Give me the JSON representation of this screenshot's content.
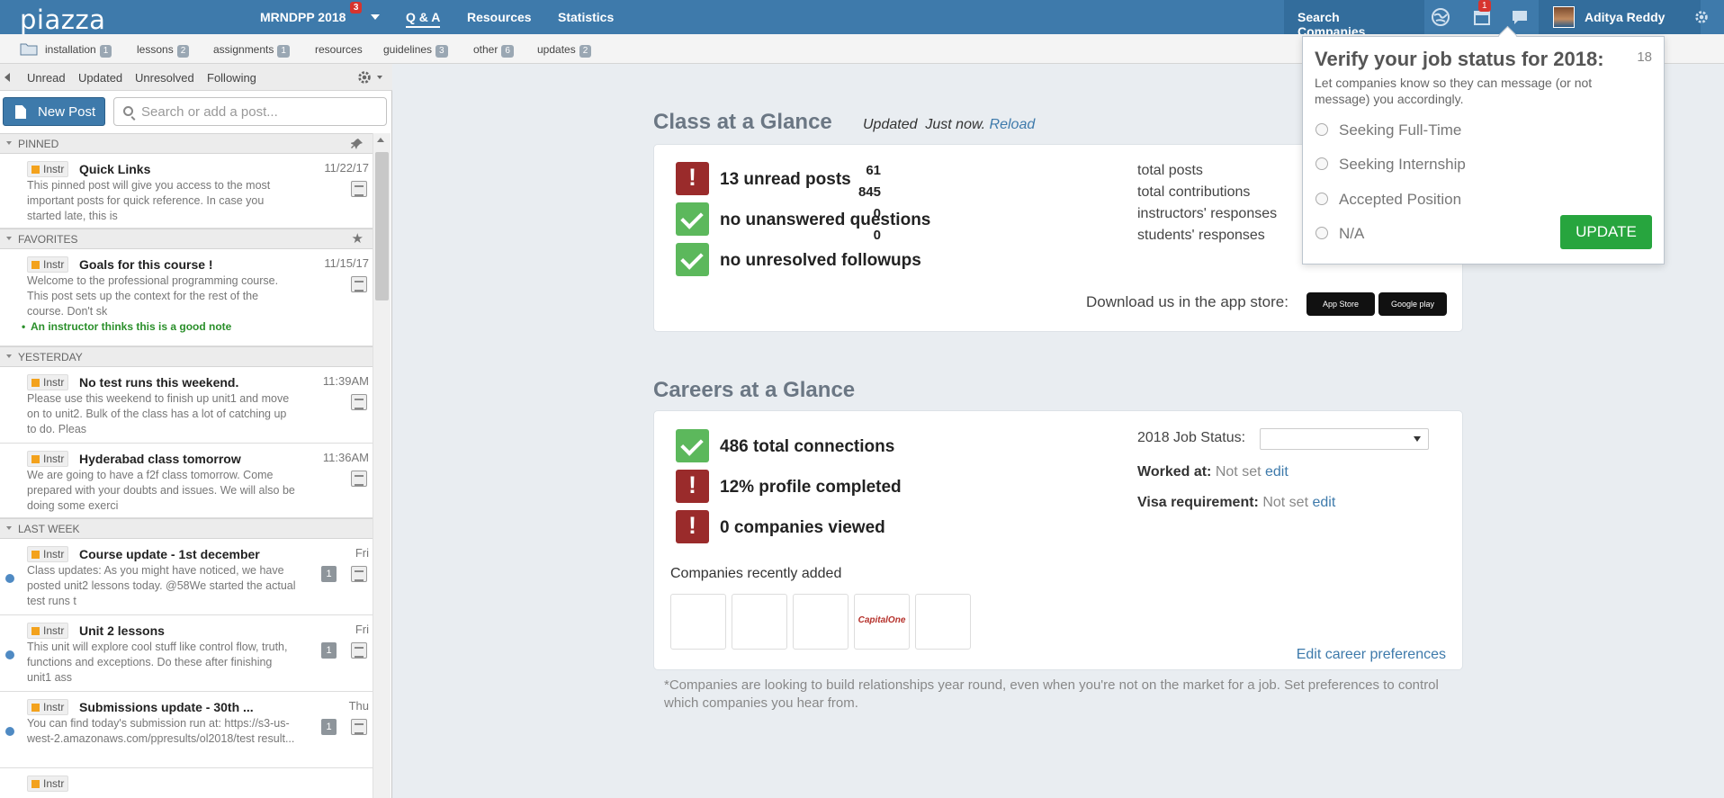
{
  "app": {
    "logo": "piazza"
  },
  "topbar": {
    "course": "MRNDPP 2018",
    "course_badge": "3",
    "nav": [
      "Q & A",
      "Resources",
      "Statistics"
    ],
    "search_companies": "Search Companies",
    "calendar_badge": "1",
    "user_name": "Aditya Reddy"
  },
  "folders": [
    {
      "label": "installation",
      "count": "1"
    },
    {
      "label": "lessons",
      "count": "2"
    },
    {
      "label": "assignments",
      "count": "1"
    },
    {
      "label": "resources",
      "count": ""
    },
    {
      "label": "guidelines",
      "count": "3"
    },
    {
      "label": "other",
      "count": "6"
    },
    {
      "label": "updates",
      "count": "2"
    }
  ],
  "filters": [
    "Unread",
    "Updated",
    "Unresolved",
    "Following"
  ],
  "sidebar": {
    "new_post": "New Post",
    "search_placeholder": "Search or add a post...",
    "sections": {
      "pinned": "PINNED",
      "favorites": "FAVORITES",
      "yesterday": "YESTERDAY",
      "last_week": "LAST WEEK"
    },
    "posts": [
      {
        "tag": "Instr",
        "title": "Quick Links",
        "date": "11/22/17",
        "body": "This pinned post will give you access to the most important posts for quick reference. In case you started late, this is"
      },
      {
        "tag": "Instr",
        "title": "Goals for this course !",
        "date": "11/15/17",
        "body": "Welcome to the professional programming course.  This post sets up the context for the rest of the course.  Don't sk",
        "note": "An instructor thinks this is a good note"
      },
      {
        "tag": "Instr",
        "title": "No test runs this weekend.",
        "date": "11:39AM",
        "body": "Please use this weekend to finish up unit1 and move on to unit2. Bulk of the class has a lot of catching up to do. Pleas"
      },
      {
        "tag": "Instr",
        "title": "Hyderabad class tomorrow",
        "date": "11:36AM",
        "body": "We are going to have a f2f class tomorrow. Come prepared with your doubts and issues. We will also be doing some exerci"
      },
      {
        "tag": "Instr",
        "title": "Course update - 1st december",
        "date": "Fri",
        "count": "1",
        "body": "Class updates:   As you might have noticed, we have posted unit2 lessons today. @58We started the actual test runs t"
      },
      {
        "tag": "Instr",
        "title": "Unit 2 lessons",
        "date": "Fri",
        "count": "1",
        "body": "This unit will explore cool stuff like control flow, truth, functions and exceptions. Do these after finishing unit1 ass"
      },
      {
        "tag": "Instr",
        "title": "Submissions update - 30th ...",
        "date": "Thu",
        "count": "1",
        "body": "You can find today's submission run at: https://s3-us-west-2.amazonaws.com/ppresults/ol2018/test  result..."
      }
    ]
  },
  "class_glance": {
    "title": "Class at a Glance",
    "updated_label": "Updated",
    "updated_value": "Just now.",
    "reload": "Reload",
    "stats": [
      "13 unread posts",
      "no unanswered questions",
      "no unresolved followups"
    ],
    "numbers": [
      {
        "value": "61",
        "label": "total posts"
      },
      {
        "value": "845",
        "label": "total contributions"
      },
      {
        "value": "0",
        "label": "instructors' responses"
      },
      {
        "value": "0",
        "label": "students' responses"
      }
    ],
    "download": "Download us in the app store:",
    "app_store": "App Store",
    "google_play": "Google play"
  },
  "careers": {
    "title": "Careers at a Glance",
    "stats": [
      "486 total connections",
      "12% profile completed",
      "0 companies viewed"
    ],
    "job_status_label": "2018 Job Status:",
    "worked_at_label": "Worked at:",
    "worked_at_value": "Not set",
    "visa_label": "Visa requirement:",
    "visa_value": "Not set",
    "edit": "edit",
    "recent_label": "Companies recently added",
    "capital_one": "CapitalOne",
    "edit_prefs": "Edit career preferences",
    "footnote": "*Companies are looking to build relationships year round, even when you're not on the market for a job. Set preferences to control which companies you hear from."
  },
  "popup": {
    "title": "Verify your job status for 2018:",
    "count": "18",
    "subtitle": "Let companies know so they can message (or not message) you accordingly.",
    "options": [
      "Seeking Full-Time",
      "Seeking Internship",
      "Accepted Position",
      "N/A"
    ],
    "button": "UPDATE"
  }
}
